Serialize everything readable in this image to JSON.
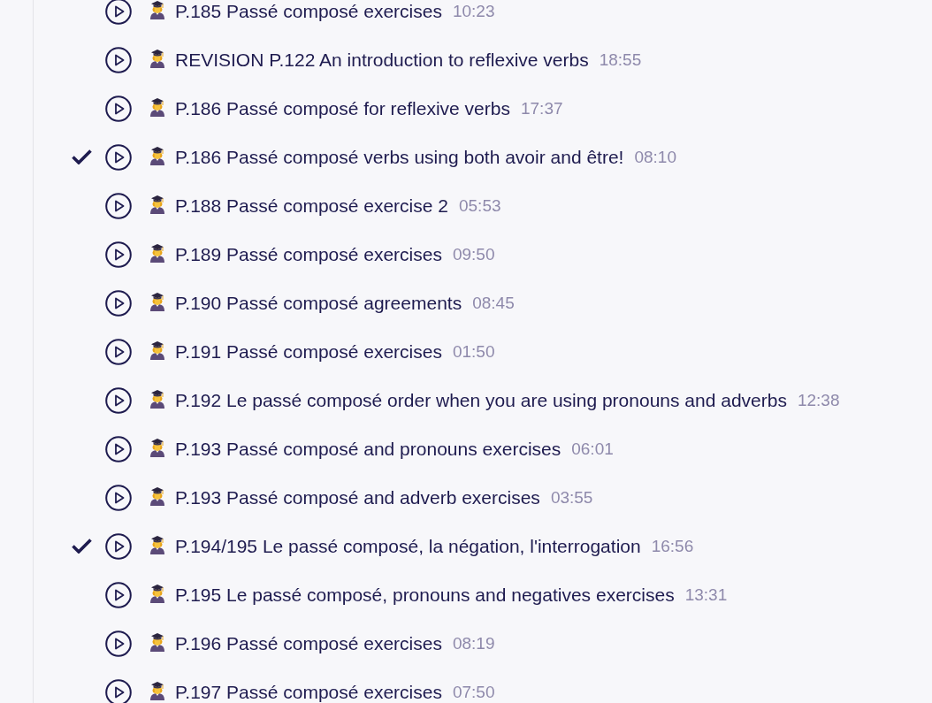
{
  "lessons": [
    {
      "title": "P.185 Passé composé exercises",
      "duration": "10:23",
      "completed": false
    },
    {
      "title": "REVISION P.122 An introduction to reflexive verbs",
      "duration": "18:55",
      "completed": false
    },
    {
      "title": "P.186 Passé composé for reflexive verbs",
      "duration": "17:37",
      "completed": false
    },
    {
      "title": "P.186 Passé composé verbs using both avoir and être!",
      "duration": "08:10",
      "completed": true
    },
    {
      "title": "P.188 Passé composé exercise 2",
      "duration": "05:53",
      "completed": false
    },
    {
      "title": "P.189 Passé composé exercises",
      "duration": "09:50",
      "completed": false
    },
    {
      "title": "P.190 Passé composé agreements",
      "duration": "08:45",
      "completed": false
    },
    {
      "title": "P.191 Passé composé exercises",
      "duration": "01:50",
      "completed": false
    },
    {
      "title": "P.192 Le passé composé order when you are using pronouns and adverbs",
      "duration": "12:38",
      "completed": false
    },
    {
      "title": "P.193 Passé composé and pronouns exercises",
      "duration": "06:01",
      "completed": false
    },
    {
      "title": "P.193 Passé composé and adverb exercises",
      "duration": "03:55",
      "completed": false
    },
    {
      "title": "P.194/195 Le passé composé, la négation, l'interrogation",
      "duration": "16:56",
      "completed": true
    },
    {
      "title": "P.195 Le passé composé, pronouns and negatives exercises",
      "duration": "13:31",
      "completed": false
    },
    {
      "title": "P.196 Passé composé exercises",
      "duration": "08:19",
      "completed": false
    },
    {
      "title": "P.197 Passé composé exercises",
      "duration": "07:50",
      "completed": false
    }
  ]
}
